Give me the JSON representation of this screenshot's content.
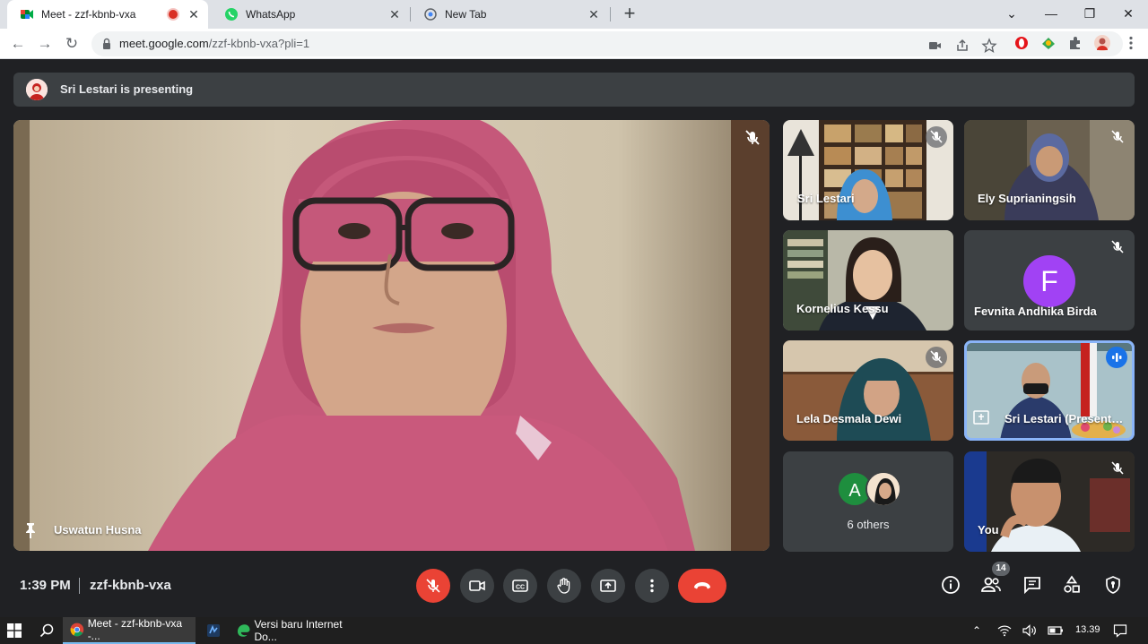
{
  "browser": {
    "tabs": [
      {
        "title": "Meet - zzf-kbnb-vxa",
        "active": true,
        "recording": true
      },
      {
        "title": "WhatsApp",
        "active": false
      },
      {
        "title": "New Tab",
        "active": false
      }
    ],
    "url_main": "meet.google.com",
    "url_path": "/zzf-kbnb-vxa?pli=1"
  },
  "meet": {
    "presenting_banner": "Sri Lestari is presenting",
    "main_speaker": "Uswatun Husna",
    "tiles": [
      {
        "name": "Sri Lestari",
        "muted": true
      },
      {
        "name": "Ely Suprianingsih",
        "muted": true
      },
      {
        "name": "Kornelius Kessu",
        "muted": false
      },
      {
        "name": "Fevnita Andhika Birda",
        "muted": true,
        "initial": "F",
        "avatar_color": "#a142f4"
      },
      {
        "name": "Lela Desmala Dewi",
        "muted": true
      },
      {
        "name": "Sri Lestari (Presenting)",
        "display": "Sri Lestari (Present…",
        "speaking": true
      },
      {
        "name": "6 others",
        "initial": "A",
        "avatar_color": "#1e8e3e"
      },
      {
        "name": "You",
        "muted": true
      }
    ]
  },
  "controls": {
    "time": "1:39 PM",
    "meeting_code": "zzf-kbnb-vxa",
    "participant_count": "14"
  },
  "taskbar": {
    "items": [
      {
        "label": "Meet - zzf-kbnb-vxa -..."
      },
      {
        "label": "Versi baru Internet Do..."
      }
    ],
    "time": "13.39"
  },
  "colors": {
    "meet_bg": "#202124",
    "end_call": "#ea4335",
    "speaking_outline": "#8ab4f8"
  }
}
